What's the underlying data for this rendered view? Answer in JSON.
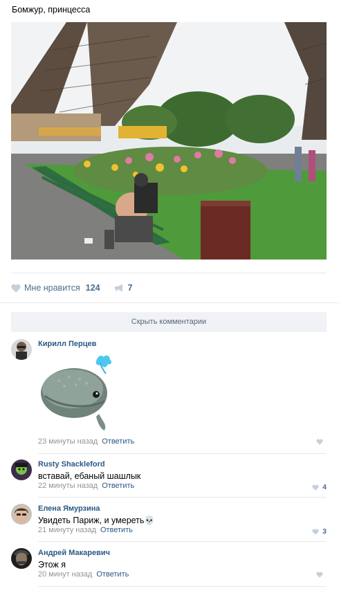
{
  "post": {
    "title": "Бомжур, принцесса"
  },
  "actions": {
    "like_label": "Мне нравится",
    "like_count": "124",
    "share_count": "7"
  },
  "hide_comments_label": "Скрыть комментарии",
  "comments": [
    {
      "name": "Кирилл Перцев",
      "text": "",
      "time": "23 минуты назад",
      "reply": "Ответить",
      "likes": "",
      "has_sticker": true,
      "sticker": "whale-sticker"
    },
    {
      "name": "Rusty Shackleford",
      "text": "вставай, ебаный шашлык",
      "time": "22 минуты назад",
      "reply": "Ответить",
      "likes": "4"
    },
    {
      "name": "Елена Ямурзина",
      "text": "Увидеть Париж, и умереть💀",
      "time": "21 минуту назад",
      "reply": "Ответить",
      "likes": "3"
    },
    {
      "name": "Андрей Макаревич",
      "text": "Этож я",
      "time": "20 минут назад",
      "reply": "Ответить",
      "likes": ""
    }
  ],
  "colors": {
    "link": "#2a5885",
    "meta": "#939393",
    "action": "#4d6c8f",
    "separator": "#e7e8ec",
    "button_bg": "#f0f2f5"
  },
  "icons": {
    "like": "heart-icon",
    "share": "megaphone-icon"
  }
}
